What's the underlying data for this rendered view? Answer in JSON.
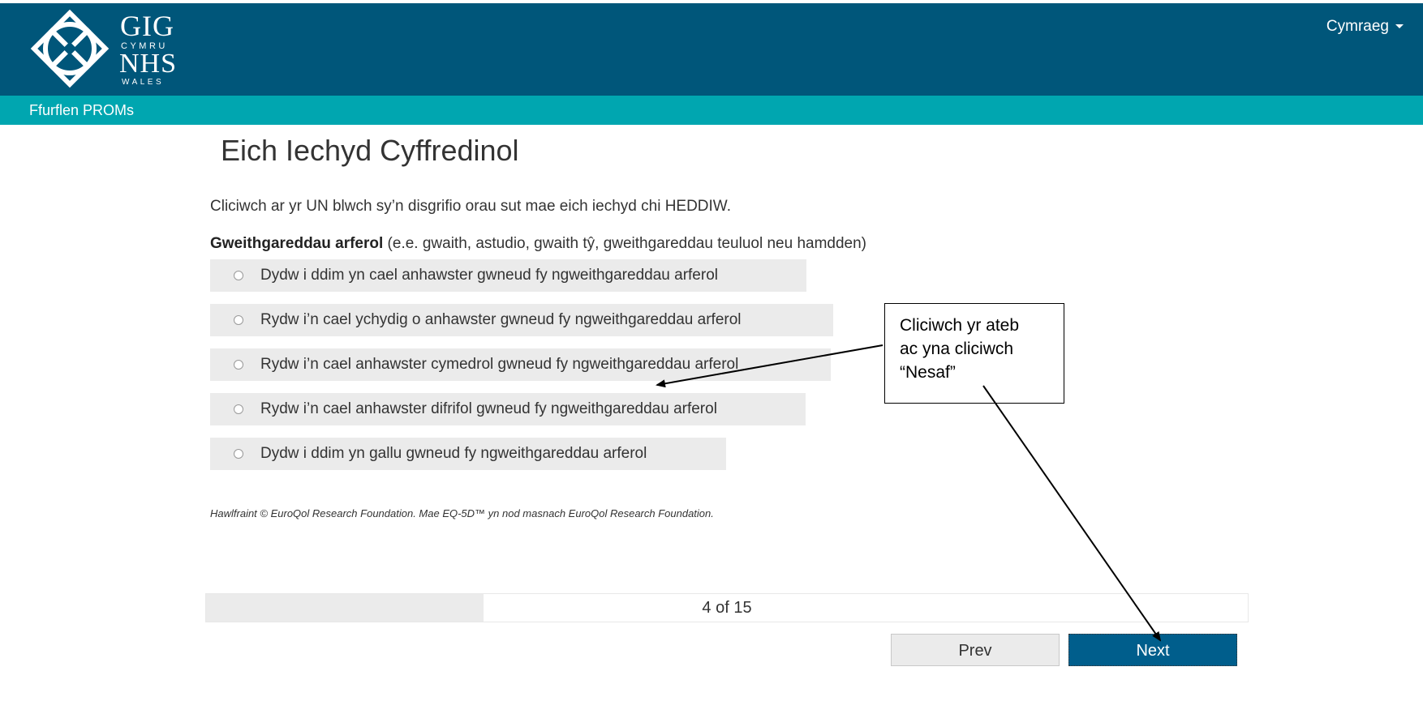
{
  "header": {
    "logo": {
      "line1": "GIG",
      "line2": "CYMRU",
      "line3": "NHS",
      "line4": "WALES"
    },
    "language_menu": "Cymraeg",
    "subtitle": "Ffurflen PROMs"
  },
  "main": {
    "title": "Eich Iechyd Cyffredinol",
    "instruction": "Cliciwch ar yr UN blwch sy’n disgrifio orau sut mae eich iechyd chi HEDDIW.",
    "question_bold": "Gweithgareddau arferol",
    "question_rest": " (e.e. gwaith, astudio, gwaith tŷ, gweithgareddau teuluol neu hamdden)",
    "options": [
      "Dydw i ddim yn cael anhawster gwneud fy ngweithgareddau arferol",
      "Rydw i’n cael ychydig o anhawster gwneud fy ngweithgareddau arferol",
      "Rydw i’n cael anhawster cymedrol gwneud fy ngweithgareddau arferol",
      "Rydw i’n cael anhawster difrifol gwneud fy ngweithgareddau arferol",
      "Dydw i ddim yn gallu gwneud fy ngweithgareddau arferol"
    ],
    "copyright": "Hawlfraint © EuroQol Research Foundation. Mae EQ-5D™ yn nod masnach EuroQol Research Foundation."
  },
  "progress": {
    "text": "4 of 15",
    "current": 4,
    "total": 15
  },
  "buttons": {
    "prev": "Prev",
    "next": "Next"
  },
  "callout": {
    "line1": "Cliciwch yr ateb",
    "line2": "ac yna cliciwch",
    "line3": "“Nesaf”"
  },
  "colors": {
    "header_bg": "#00567a",
    "subbar_bg": "#00a6b0",
    "next_button_bg": "#005e8c",
    "option_bg": "#ebebeb"
  }
}
